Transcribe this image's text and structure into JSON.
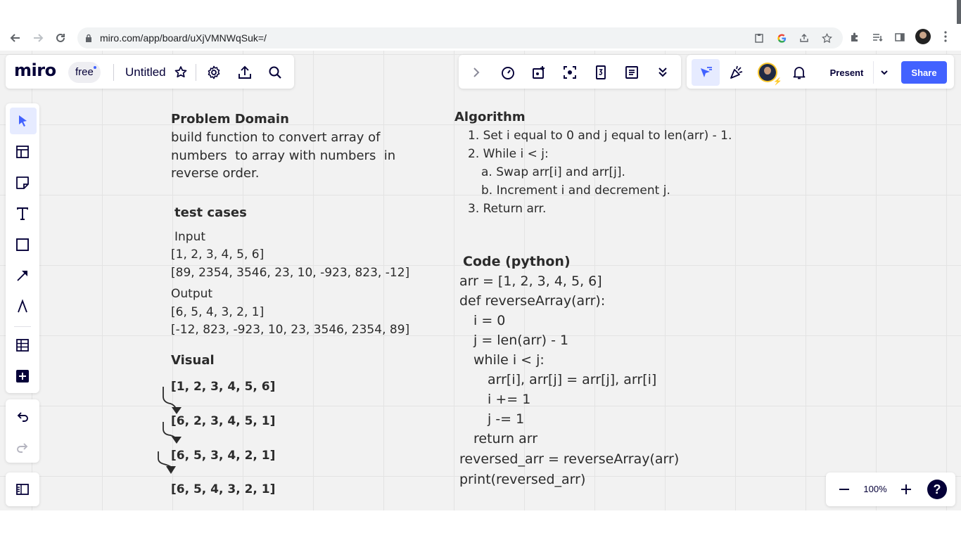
{
  "browser": {
    "url": "miro.com/app/board/uXjVMNWqSuk=/"
  },
  "miro": {
    "logo": "miro",
    "plan_badge": "free",
    "board_title": "Untitled",
    "present_label": "Present",
    "share_label": "Share",
    "zoom_level": "100%",
    "help_label": "?",
    "accent_color": "#4262ff"
  },
  "board": {
    "problem_domain": {
      "heading": "Problem Domain",
      "lines": [
        "build function to convert array of",
        "numbers  to array with numbers  in",
        "reverse order."
      ]
    },
    "test_cases": {
      "heading": "test cases",
      "input_label": "Input",
      "inputs": [
        "[1, 2, 3, 4, 5, 6]",
        "[89, 2354, 3546, 23, 10, -923, 823, -12]"
      ],
      "output_label": "Output",
      "outputs": [
        "[6, 5, 4, 3, 2, 1]",
        "[-12, 823, -923, 10, 23, 3546, 2354, 89]"
      ]
    },
    "visual": {
      "heading": "Visual",
      "steps": [
        "[1, 2, 3, 4, 5, 6]",
        "[6, 2, 3, 4, 5, 1]",
        "[6, 5, 3, 4, 2, 1]",
        "[6, 5, 4, 3, 2, 1]"
      ]
    },
    "algorithm": {
      "heading": "Algorithm",
      "lines": [
        "1. Set i equal to 0 and j equal to len(arr) - 1.",
        "2. While i < j:",
        "a. Swap arr[i] and arr[j].",
        "b. Increment i and decrement j.",
        "3. Return arr."
      ]
    },
    "code": {
      "heading": "Code (python)",
      "lines": [
        "arr = [1, 2, 3, 4, 5, 6]",
        "def reverseArray(arr):",
        "i = 0",
        "j = len(arr) - 1",
        "while i < j:",
        "arr[i], arr[j] = arr[j], arr[i]",
        "i += 1",
        "j -= 1",
        "return arr",
        "reversed_arr = reverseArray(arr)",
        "print(reversed_arr)"
      ]
    }
  }
}
